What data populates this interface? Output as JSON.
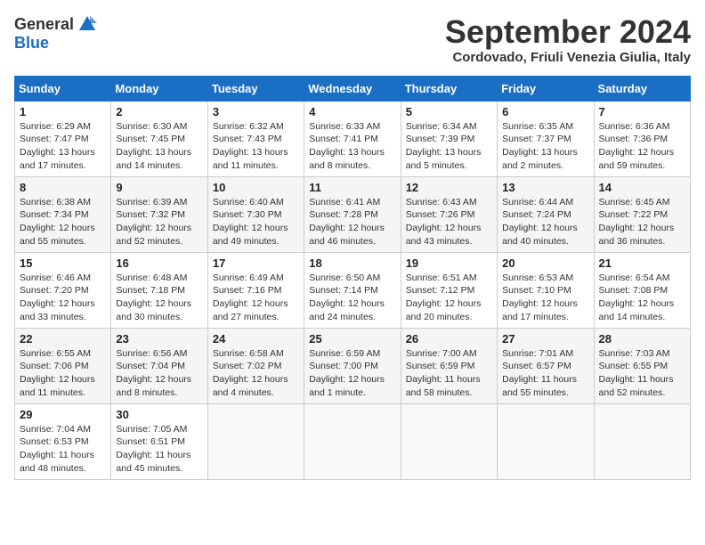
{
  "header": {
    "logo_general": "General",
    "logo_blue": "Blue",
    "title": "September 2024",
    "location": "Cordovado, Friuli Venezia Giulia, Italy"
  },
  "weekdays": [
    "Sunday",
    "Monday",
    "Tuesday",
    "Wednesday",
    "Thursday",
    "Friday",
    "Saturday"
  ],
  "weeks": [
    [
      {
        "day": "1",
        "sunrise": "6:29 AM",
        "sunset": "7:47 PM",
        "daylight": "13 hours and 17 minutes."
      },
      {
        "day": "2",
        "sunrise": "6:30 AM",
        "sunset": "7:45 PM",
        "daylight": "13 hours and 14 minutes."
      },
      {
        "day": "3",
        "sunrise": "6:32 AM",
        "sunset": "7:43 PM",
        "daylight": "13 hours and 11 minutes."
      },
      {
        "day": "4",
        "sunrise": "6:33 AM",
        "sunset": "7:41 PM",
        "daylight": "13 hours and 8 minutes."
      },
      {
        "day": "5",
        "sunrise": "6:34 AM",
        "sunset": "7:39 PM",
        "daylight": "13 hours and 5 minutes."
      },
      {
        "day": "6",
        "sunrise": "6:35 AM",
        "sunset": "7:37 PM",
        "daylight": "13 hours and 2 minutes."
      },
      {
        "day": "7",
        "sunrise": "6:36 AM",
        "sunset": "7:36 PM",
        "daylight": "12 hours and 59 minutes."
      }
    ],
    [
      {
        "day": "8",
        "sunrise": "6:38 AM",
        "sunset": "7:34 PM",
        "daylight": "12 hours and 55 minutes."
      },
      {
        "day": "9",
        "sunrise": "6:39 AM",
        "sunset": "7:32 PM",
        "daylight": "12 hours and 52 minutes."
      },
      {
        "day": "10",
        "sunrise": "6:40 AM",
        "sunset": "7:30 PM",
        "daylight": "12 hours and 49 minutes."
      },
      {
        "day": "11",
        "sunrise": "6:41 AM",
        "sunset": "7:28 PM",
        "daylight": "12 hours and 46 minutes."
      },
      {
        "day": "12",
        "sunrise": "6:43 AM",
        "sunset": "7:26 PM",
        "daylight": "12 hours and 43 minutes."
      },
      {
        "day": "13",
        "sunrise": "6:44 AM",
        "sunset": "7:24 PM",
        "daylight": "12 hours and 40 minutes."
      },
      {
        "day": "14",
        "sunrise": "6:45 AM",
        "sunset": "7:22 PM",
        "daylight": "12 hours and 36 minutes."
      }
    ],
    [
      {
        "day": "15",
        "sunrise": "6:46 AM",
        "sunset": "7:20 PM",
        "daylight": "12 hours and 33 minutes."
      },
      {
        "day": "16",
        "sunrise": "6:48 AM",
        "sunset": "7:18 PM",
        "daylight": "12 hours and 30 minutes."
      },
      {
        "day": "17",
        "sunrise": "6:49 AM",
        "sunset": "7:16 PM",
        "daylight": "12 hours and 27 minutes."
      },
      {
        "day": "18",
        "sunrise": "6:50 AM",
        "sunset": "7:14 PM",
        "daylight": "12 hours and 24 minutes."
      },
      {
        "day": "19",
        "sunrise": "6:51 AM",
        "sunset": "7:12 PM",
        "daylight": "12 hours and 20 minutes."
      },
      {
        "day": "20",
        "sunrise": "6:53 AM",
        "sunset": "7:10 PM",
        "daylight": "12 hours and 17 minutes."
      },
      {
        "day": "21",
        "sunrise": "6:54 AM",
        "sunset": "7:08 PM",
        "daylight": "12 hours and 14 minutes."
      }
    ],
    [
      {
        "day": "22",
        "sunrise": "6:55 AM",
        "sunset": "7:06 PM",
        "daylight": "12 hours and 11 minutes."
      },
      {
        "day": "23",
        "sunrise": "6:56 AM",
        "sunset": "7:04 PM",
        "daylight": "12 hours and 8 minutes."
      },
      {
        "day": "24",
        "sunrise": "6:58 AM",
        "sunset": "7:02 PM",
        "daylight": "12 hours and 4 minutes."
      },
      {
        "day": "25",
        "sunrise": "6:59 AM",
        "sunset": "7:00 PM",
        "daylight": "12 hours and 1 minute."
      },
      {
        "day": "26",
        "sunrise": "7:00 AM",
        "sunset": "6:59 PM",
        "daylight": "11 hours and 58 minutes."
      },
      {
        "day": "27",
        "sunrise": "7:01 AM",
        "sunset": "6:57 PM",
        "daylight": "11 hours and 55 minutes."
      },
      {
        "day": "28",
        "sunrise": "7:03 AM",
        "sunset": "6:55 PM",
        "daylight": "11 hours and 52 minutes."
      }
    ],
    [
      {
        "day": "29",
        "sunrise": "7:04 AM",
        "sunset": "6:53 PM",
        "daylight": "11 hours and 48 minutes."
      },
      {
        "day": "30",
        "sunrise": "7:05 AM",
        "sunset": "6:51 PM",
        "daylight": "11 hours and 45 minutes."
      },
      null,
      null,
      null,
      null,
      null
    ]
  ]
}
